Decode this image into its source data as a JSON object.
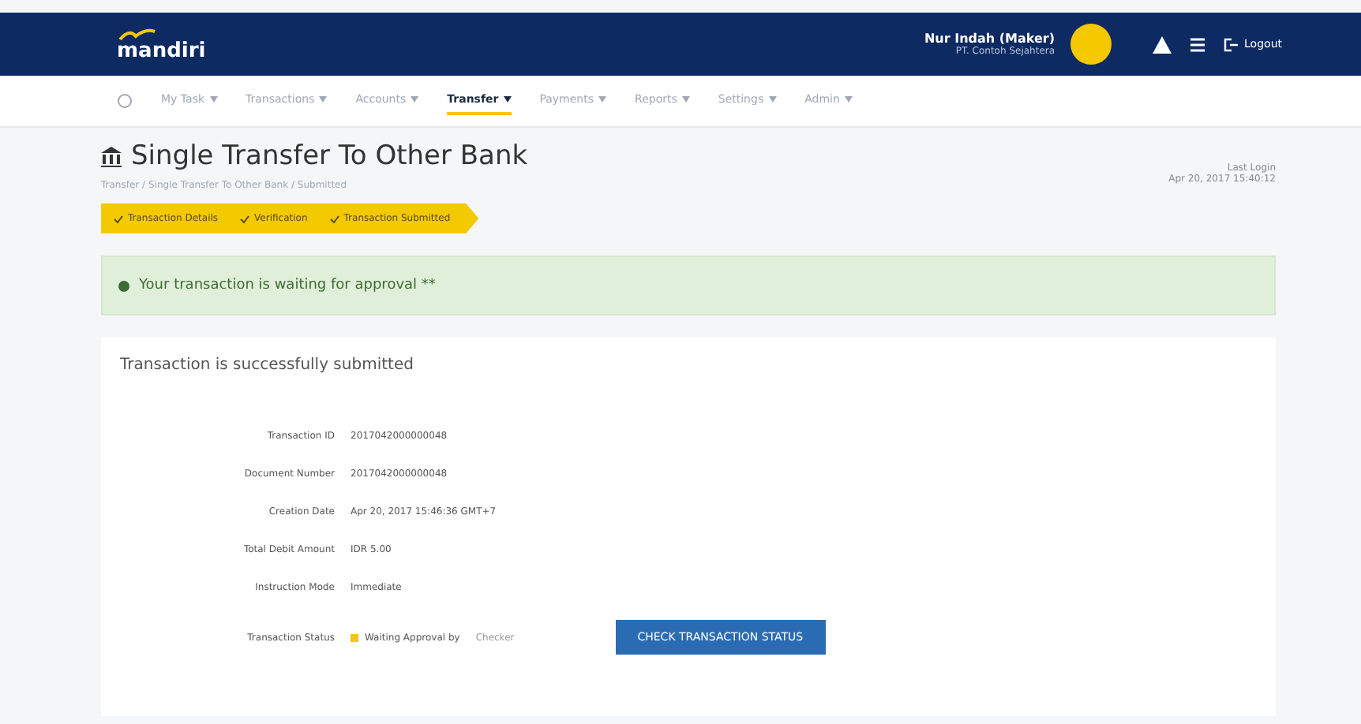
{
  "header": {
    "logo": "mandiri",
    "user_name": "Nur Indah (Maker)",
    "user_company": "PT. Contoh Sejahtera",
    "logout": "Logout"
  },
  "menu": [
    {
      "label": "My Task",
      "selected": false
    },
    {
      "label": "Transactions",
      "selected": false
    },
    {
      "label": "Accounts",
      "selected": false
    },
    {
      "label": "Transfer",
      "selected": true
    },
    {
      "label": "Payments",
      "selected": false
    },
    {
      "label": "Reports",
      "selected": false
    },
    {
      "label": "Settings",
      "selected": false
    },
    {
      "label": "Admin",
      "selected": false
    }
  ],
  "page": {
    "title": "Single Transfer To Other Bank",
    "breadcrumb": "Transfer / Single Transfer To Other Bank / Submitted",
    "last_login_label": "Last Login",
    "last_login": "Apr 20, 2017 15:40:12"
  },
  "steps": [
    {
      "label": "Transaction Details"
    },
    {
      "label": "Verification"
    },
    {
      "label": "Transaction Submitted"
    }
  ],
  "alert": {
    "text": "Your transaction is waiting for approval **"
  },
  "card": {
    "title": "Transaction is successfully submitted",
    "rows": [
      {
        "label": "Transaction ID",
        "value": "2017042000000048"
      },
      {
        "label": "Document Number",
        "value": "2017042000000048"
      },
      {
        "label": "Creation Date",
        "value": "Apr 20, 2017 15:46:36 GMT+7"
      },
      {
        "label": "Total Debit Amount",
        "value": "IDR 5.00"
      },
      {
        "label": "Instruction Mode",
        "value": "Immediate"
      },
      {
        "label": "Transaction Status",
        "value": "Waiting Approval by",
        "note": "Checker",
        "kind": "status"
      }
    ],
    "button": "CHECK TRANSACTION STATUS"
  }
}
